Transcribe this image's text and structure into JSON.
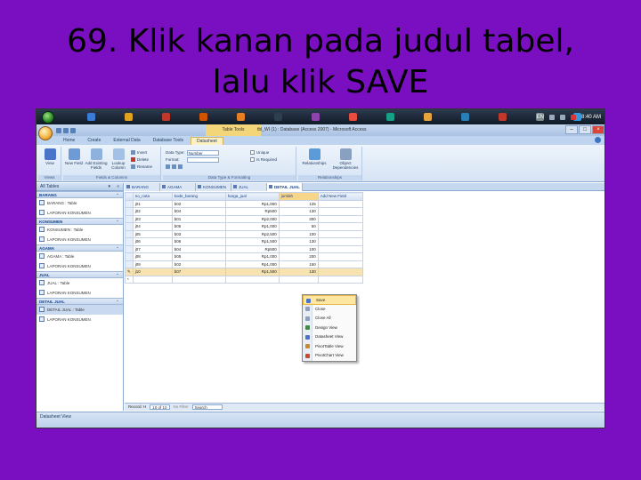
{
  "slide_title": "69. Klik kanan pada judul tabel, lalu klik SAVE",
  "taskbar": {
    "language": "EN",
    "clock": "8:40 AM",
    "icon_colors": [
      "#3a7bd5",
      "#e0a020",
      "#c0392b",
      "#d35400",
      "#e67e22",
      "#2c3e50",
      "#8e44ad",
      "#e74c3c",
      "#16a085",
      "#e8a33c",
      "#2980b9",
      "#c0392b",
      "#7f8c8d",
      "#3498db"
    ]
  },
  "window": {
    "context_tab_label": "Table Tools",
    "title": "tbl_WI (1) : Database (Access 2007) - Microsoft Access",
    "ribbon_tabs": [
      "Home",
      "Create",
      "External Data",
      "Database Tools",
      "Datasheet"
    ],
    "active_tab": "Datasheet"
  },
  "ribbon": {
    "views_group": {
      "label": "Views",
      "view_button": "View"
    },
    "fields_group": {
      "label": "Fields & Columns",
      "new_field": "New Field",
      "add_existing": "Add Existing Fields",
      "lookup": "Lookup Column",
      "insert": "Insert",
      "delete": "Delete",
      "rename": "Rename"
    },
    "format_group": {
      "label": "Data Type & Formatting",
      "data_type_label": "Data Type:",
      "data_type_value": "Number",
      "format_label": "Format:",
      "format_value": "",
      "unique": "Unique",
      "is_required": "Is Required"
    },
    "relationships_group": {
      "label": "Relationships",
      "relationships": "Relationships",
      "object_dependencies": "Object Dependencies"
    }
  },
  "navpane": {
    "header": "All Tables",
    "groups": [
      {
        "name": "BARANG",
        "items": [
          {
            "label": "BARANG : Table"
          },
          {
            "label": "LAPORAN KONSUMEN"
          }
        ]
      },
      {
        "name": "KONSUMEN",
        "items": [
          {
            "label": "KONSUMEN : Table"
          },
          {
            "label": "LAPORAN KONSUMEN"
          }
        ]
      },
      {
        "name": "AGAMA",
        "items": [
          {
            "label": "AGAMA : Table"
          },
          {
            "label": "LAPORAN KONSUMEN"
          }
        ]
      },
      {
        "name": "JUAL",
        "items": [
          {
            "label": "JUAL : Table"
          },
          {
            "label": "LAPORAN KONSUMEN"
          }
        ]
      },
      {
        "name": "DETAIL JUAL",
        "items": [
          {
            "label": "DETAIL JUAL : Table"
          },
          {
            "label": "LAPORAN KONSUMEN"
          }
        ]
      }
    ]
  },
  "doc_tabs": [
    "BARANG",
    "AGAMA",
    "KONSUMEN",
    "JUAL",
    "DETAIL JUAL"
  ],
  "active_doc_tab": "DETAIL JUAL",
  "table": {
    "columns": [
      "no_nota",
      "kode_barang",
      "harga_jual",
      "jumlah",
      "Add New Field"
    ],
    "rows": [
      [
        "j01",
        "b02",
        "Rp1,000",
        "125"
      ],
      [
        "j02",
        "b04",
        "Rp500",
        "130"
      ],
      [
        "j03",
        "b01",
        "Rp2,000",
        "300"
      ],
      [
        "j04",
        "b05",
        "Rp1,000",
        "50"
      ],
      [
        "j05",
        "b03",
        "Rp2,500",
        "100"
      ],
      [
        "j06",
        "b06",
        "Rp1,500",
        "130"
      ],
      [
        "j07",
        "b04",
        "Rp500",
        "100"
      ],
      [
        "j08",
        "b05",
        "Rp1,000",
        "200"
      ],
      [
        "j09",
        "b02",
        "Rp1,000",
        "150"
      ],
      [
        "j10",
        "b07",
        "Rp1,500",
        "130"
      ]
    ]
  },
  "context_menu": {
    "items": [
      {
        "label": "Save",
        "color": "#4a74c9"
      },
      {
        "label": "Close",
        "color": "#8aa0c0"
      },
      {
        "label": "Close All",
        "color": "#8aa0c0"
      },
      {
        "label": "Design View",
        "color": "#3b8e3b"
      },
      {
        "label": "Datasheet View",
        "color": "#4a74c9"
      },
      {
        "label": "PivotTable View",
        "color": "#c98b2a"
      },
      {
        "label": "PivotChart View",
        "color": "#c94a2a"
      }
    ]
  },
  "record_nav": {
    "prefix": "Record: H",
    "position": "10 of 10",
    "filter": "No Filter",
    "search": "Search"
  },
  "status": "Datasheet View"
}
